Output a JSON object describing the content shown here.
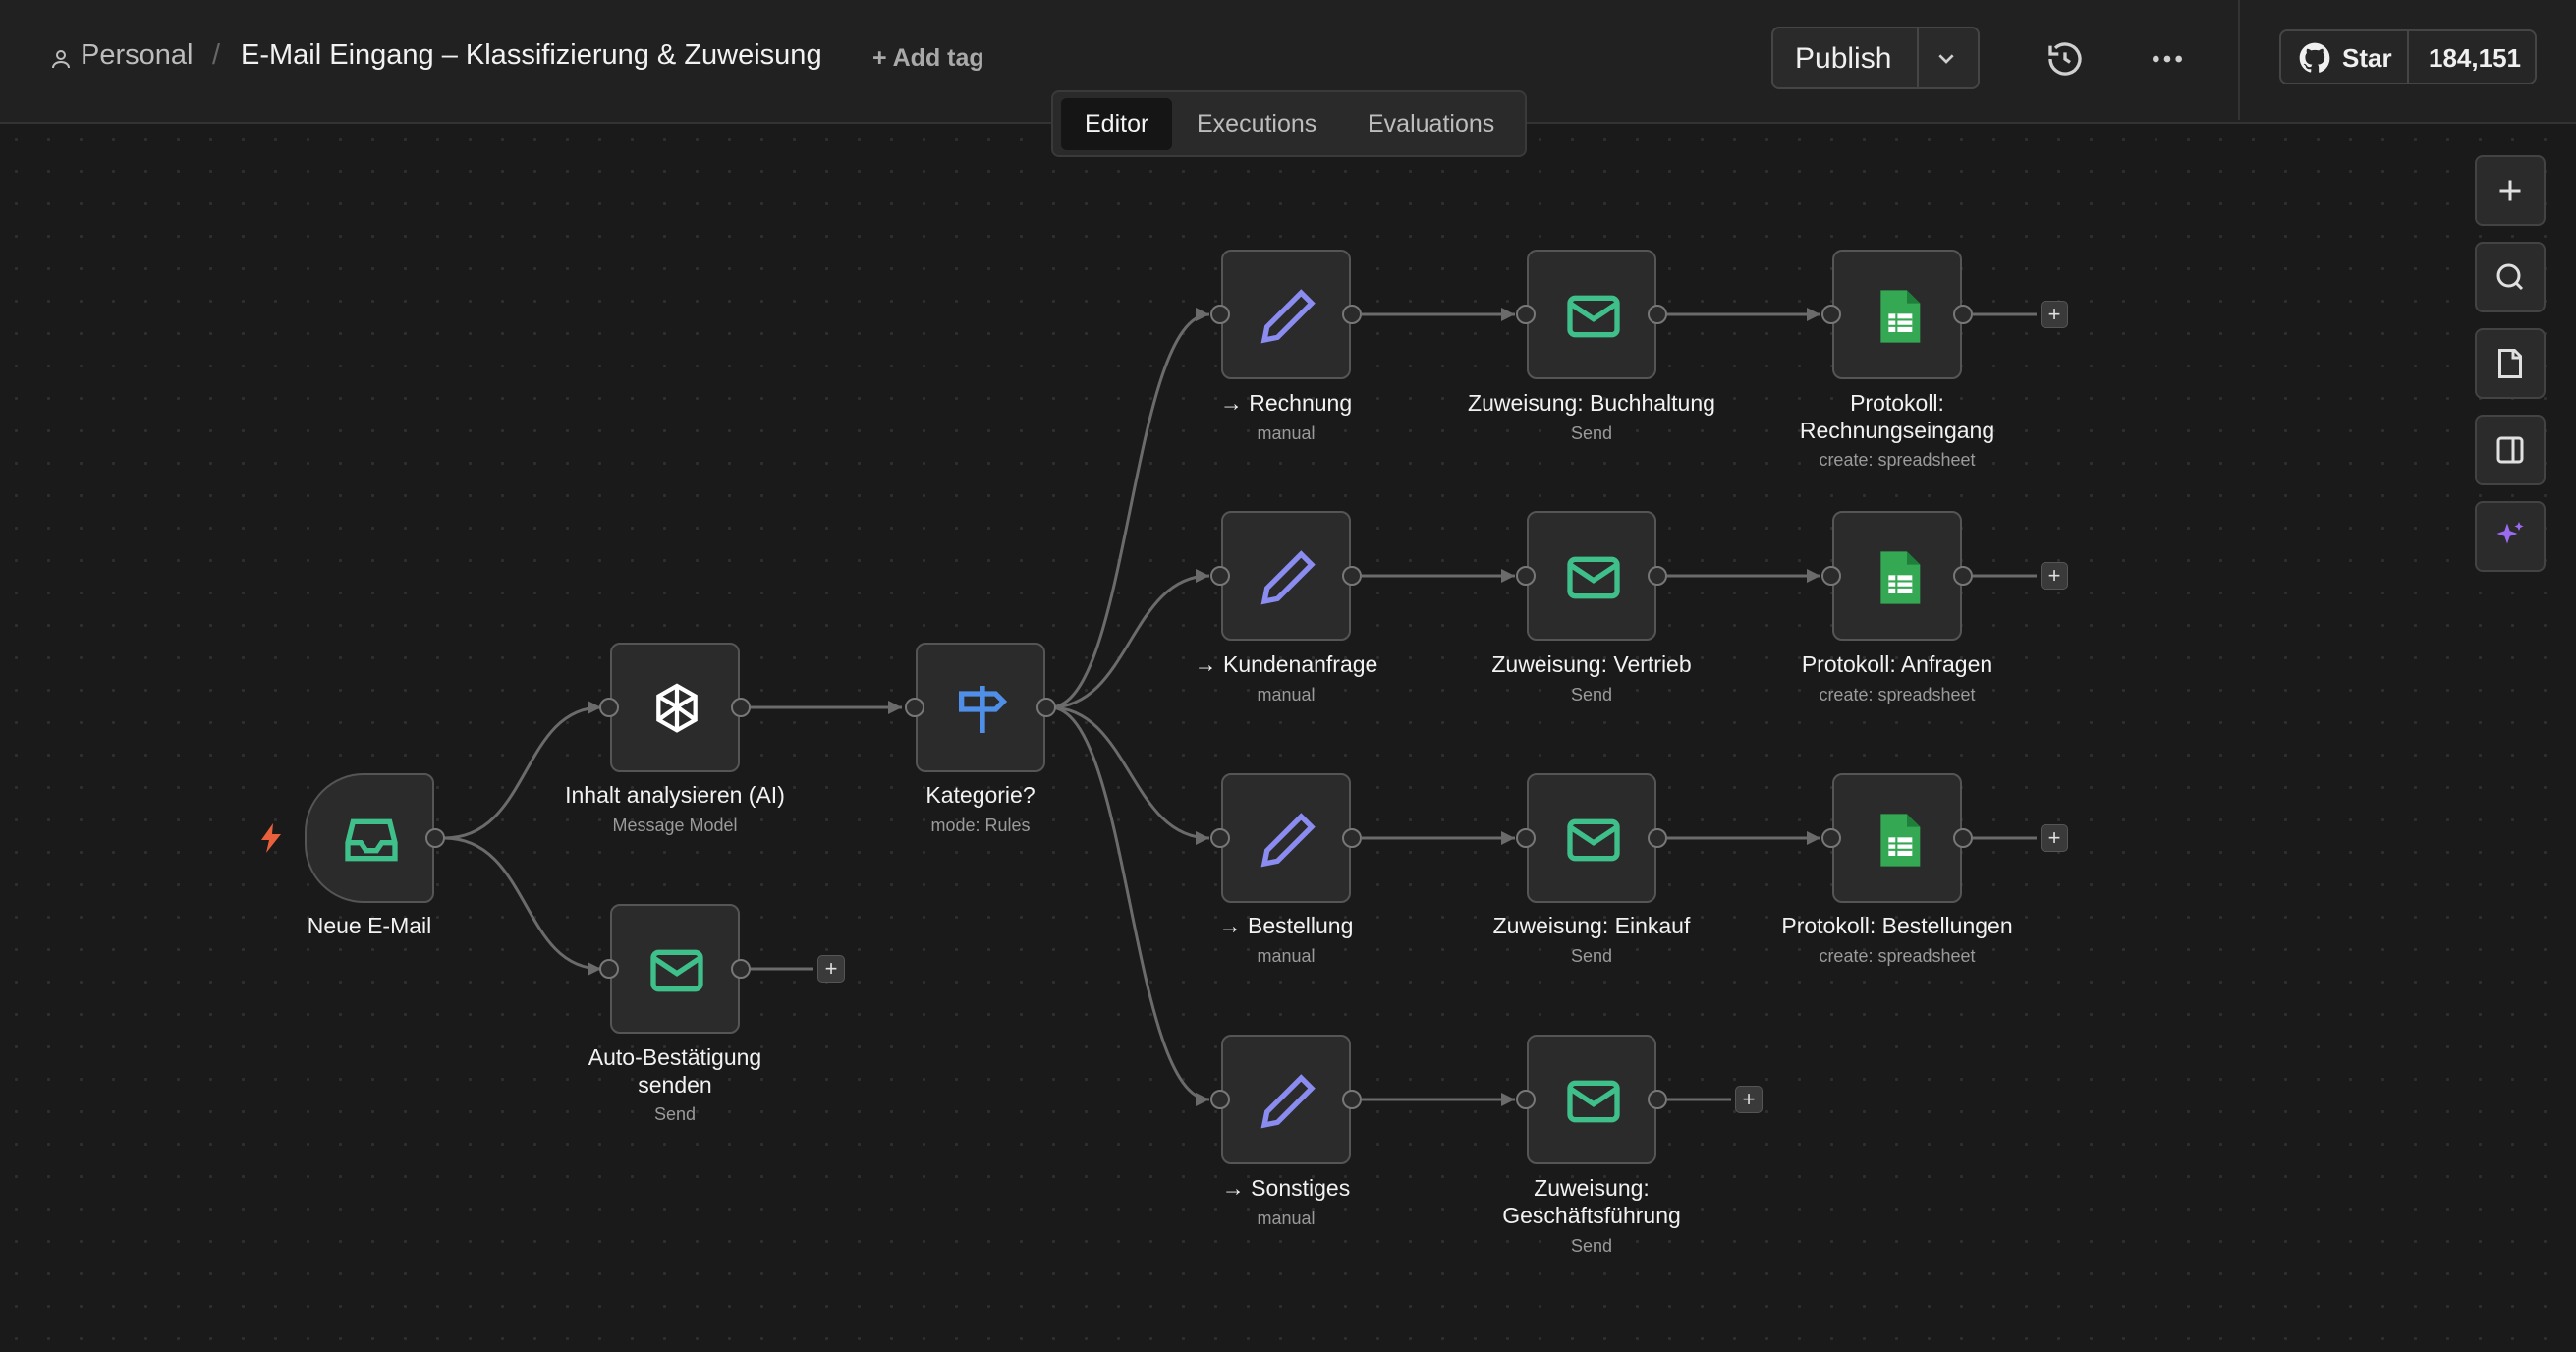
{
  "header": {
    "breadcrumb_project": "Personal",
    "breadcrumb_sep": "/",
    "workflow_title": "E-Mail Eingang – Klassifizierung & Zuweisung",
    "add_tag": "+ Add tag",
    "publish_label": "Publish",
    "github_star_label": "Star",
    "github_star_count": "184,151"
  },
  "tabs": [
    "Editor",
    "Executions",
    "Evaluations"
  ],
  "active_tab": "Editor",
  "colors": {
    "accent_green": "#3fbf8a",
    "ai_white": "#ffffff",
    "router_blue": "#4f8fe8",
    "edit_purple": "#8a8cf0",
    "sheets_green": "#34a853",
    "trigger_red": "#e8603c",
    "magic_purple": "#9b6cf0"
  },
  "nodes": {
    "trigger": {
      "label": "Neue E-Mail"
    },
    "ai": {
      "label": "Inhalt analysieren (AI)",
      "sub": "Message Model"
    },
    "autoreply": {
      "label1": "Auto-Bestätigung",
      "label2": "senden",
      "sub": "Send"
    },
    "router": {
      "label": "Kategorie?",
      "sub": "mode: Rules"
    },
    "set_rechnung": {
      "label": "→ Rechnung",
      "sub": "manual"
    },
    "set_anfrage": {
      "label": "→ Kundenanfrage",
      "sub": "manual"
    },
    "set_bestellung": {
      "label": "→ Bestellung",
      "sub": "manual"
    },
    "set_sonstiges": {
      "label": "→ Sonstiges",
      "sub": "manual"
    },
    "mail_buchhaltung": {
      "label": "Zuweisung: Buchhaltung",
      "sub": "Send"
    },
    "mail_vertrieb": {
      "label": "Zuweisung: Vertrieb",
      "sub": "Send"
    },
    "mail_einkauf": {
      "label": "Zuweisung: Einkauf",
      "sub": "Send"
    },
    "mail_gf": {
      "label1": "Zuweisung:",
      "label2": "Geschäftsführung",
      "sub": "Send"
    },
    "sheet_rechnung": {
      "label1": "Protokoll:",
      "label2": "Rechnungseingang",
      "sub": "create: spreadsheet"
    },
    "sheet_anfragen": {
      "label": "Protokoll: Anfragen",
      "sub": "create: spreadsheet"
    },
    "sheet_bestellungen": {
      "label": "Protokoll: Bestellungen",
      "sub": "create: spreadsheet"
    }
  },
  "plus_symbol": "+"
}
